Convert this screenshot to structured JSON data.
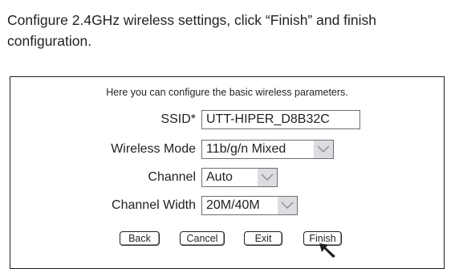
{
  "instruction": "Configure 2.4GHz wireless settings, click “Finish” and finish configuration.",
  "panel": {
    "intro": "Here you can configure the basic wireless parameters.",
    "ssid_label": "SSID*",
    "ssid_value": "UTT-HIPER_D8B32C",
    "mode_label": "Wireless Mode",
    "mode_value": "11b/g/n Mixed",
    "channel_label": "Channel",
    "channel_value": "Auto",
    "width_label": "Channel Width",
    "width_value": "20M/40M"
  },
  "buttons": {
    "back": "Back",
    "cancel": "Cancel",
    "exit": "Exit",
    "finish": "Finish"
  }
}
